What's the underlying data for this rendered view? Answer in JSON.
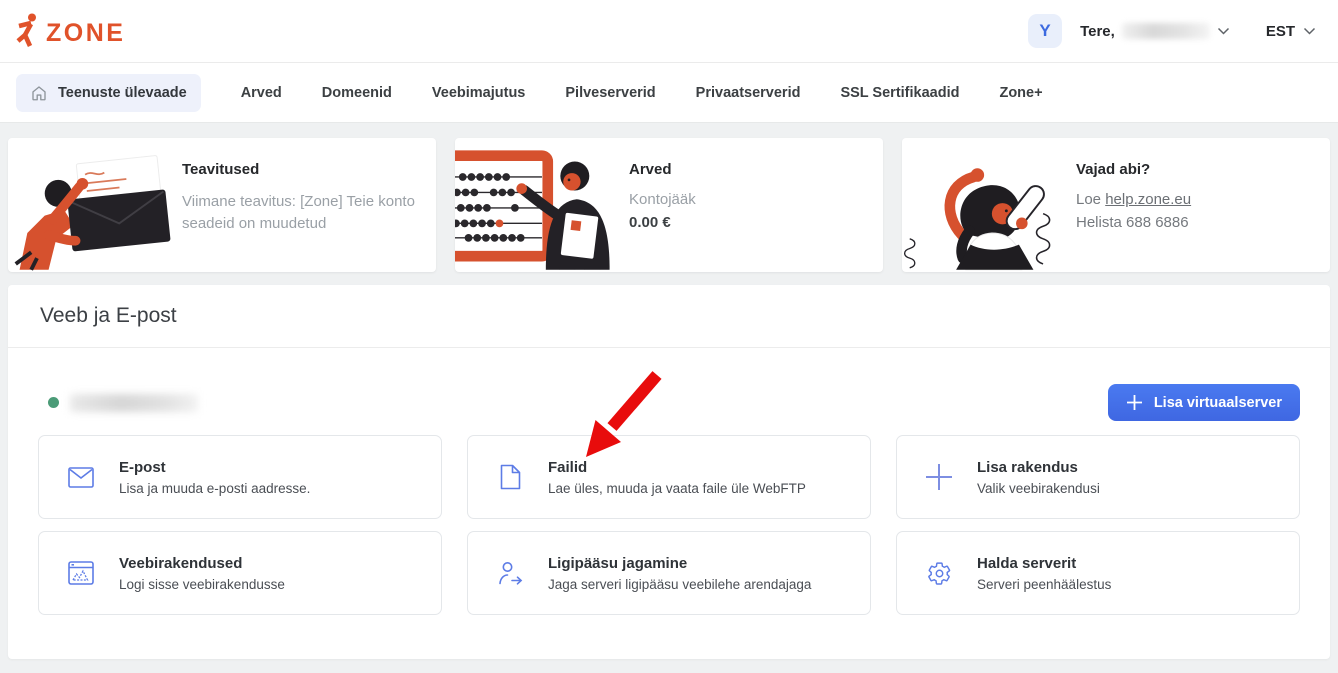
{
  "header": {
    "logo_alt": "zone",
    "avatar_initial": "Y",
    "greeting": "Tere,",
    "language": "EST"
  },
  "nav": {
    "items": [
      {
        "label": "Teenuste ülevaade",
        "active": true
      },
      {
        "label": "Arved"
      },
      {
        "label": "Domeenid"
      },
      {
        "label": "Veebimajutus"
      },
      {
        "label": "Pilveserverid"
      },
      {
        "label": "Privaatserverid"
      },
      {
        "label": "SSL Sertifikaadid"
      },
      {
        "label": "Zone+"
      }
    ]
  },
  "info_cards": {
    "notifications": {
      "title": "Teavitused",
      "description": "Viimane teavitus: [Zone] Teie konto seadeid on muudetud"
    },
    "invoices": {
      "title": "Arved",
      "balance_label": "Kontojääk",
      "balance_value": "0.00 €"
    },
    "help": {
      "title": "Vajad abi?",
      "read_prefix": "Loe ",
      "link_text": "help.zone.eu",
      "phone_line": "Helista 688 6886"
    }
  },
  "section": {
    "title": "Veeb ja E-post",
    "add_button_label": "Lisa virtuaalserver",
    "cards": [
      {
        "icon": "envelope-icon",
        "title": "E-post",
        "description": "Lisa ja muuda e-posti aadresse."
      },
      {
        "icon": "file-icon",
        "title": "Failid",
        "description": "Lae üles, muuda ja vaata faile üle WebFTP"
      },
      {
        "icon": "plus-icon",
        "title": "Lisa rakendus",
        "description": "Valik veebirakendusi"
      },
      {
        "icon": "browser-icon",
        "title": "Veebirakendused",
        "description": "Logi sisse veebirakendusse"
      },
      {
        "icon": "share-access-icon",
        "title": "Ligipääsu jagamine",
        "description": "Jaga serveri ligipääsu veebilehe arendajaga"
      },
      {
        "icon": "gear-icon",
        "title": "Halda serverit",
        "description": "Serveri peenhäälestus"
      }
    ]
  },
  "annotation": {
    "type": "red-arrow",
    "points_to": "Failid"
  },
  "colors": {
    "brand_orange": "#e0522a",
    "button_blue": "#4371e9",
    "icon_blue": "#5d7ce6",
    "active_tab_bg": "#eef1fb",
    "status_green": "#4b9b77",
    "arrow_red": "#e80c0c"
  }
}
